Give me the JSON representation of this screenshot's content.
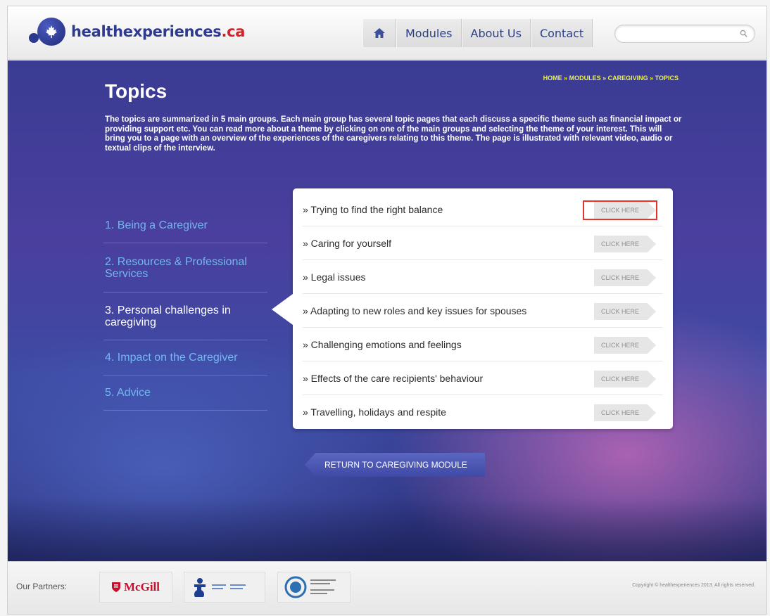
{
  "header": {
    "logo_text": "healthexperiences",
    "logo_tld": ".ca",
    "nav": [
      {
        "label": "",
        "icon": "home-icon"
      },
      {
        "label": "Modules"
      },
      {
        "label": "About Us"
      },
      {
        "label": "Contact"
      }
    ],
    "search": {
      "placeholder": "",
      "value": ""
    }
  },
  "breadcrumb": "HOME » MODULES » CAREGIVING » TOPICS",
  "page": {
    "title": "Topics",
    "intro": "The topics are summarized in 5 main groups. Each main group has several topic pages that each discuss a specific theme such as financial impact or providing support etc. You can read more about a theme by clicking on one of the main groups and selecting the theme of your interest. This will bring you to a page with an overview of the experiences of the caregivers relating to this theme. The page is illustrated with relevant video, audio or textual clips of the interview."
  },
  "groups": [
    {
      "label": "1. Being a Caregiver",
      "active": false
    },
    {
      "label": "2. Resources & Professional Services",
      "active": false
    },
    {
      "label": "3. Personal challenges in caregiving",
      "active": true
    },
    {
      "label": "4. Impact on the Caregiver",
      "active": false
    },
    {
      "label": "5. Advice",
      "active": false
    }
  ],
  "topics": [
    {
      "label": "» Trying to find the right balance",
      "button": "CLICK HERE",
      "highlighted": true
    },
    {
      "label": "» Caring for yourself",
      "button": "CLICK HERE"
    },
    {
      "label": "» Legal issues",
      "button": "CLICK HERE"
    },
    {
      "label": "» Adapting to new roles and key issues for spouses",
      "button": "CLICK HERE"
    },
    {
      "label": "» Challenging emotions and feelings",
      "button": "CLICK HERE"
    },
    {
      "label": "» Effects of the care recipients' behaviour",
      "button": "CLICK HERE"
    },
    {
      "label": "» Travelling, holidays and respite",
      "button": "CLICK HERE"
    }
  ],
  "return_button": "RETURN TO CAREGIVING MODULE",
  "footer": {
    "partners_label": "Our Partners:",
    "partners": [
      {
        "name": "McGill",
        "icon": "mcgill-crest-icon"
      },
      {
        "name": "",
        "icon": "partner-figure-logo-icon"
      },
      {
        "name": "",
        "icon": "partner-globe-logo-icon"
      }
    ],
    "copyright": "Copyright © healthexperiences 2013. All rights reserved."
  },
  "colors": {
    "brand_blue": "#2d3a8f",
    "brand_red": "#d2232a",
    "breadcrumb_yellow": "#e7ef5b",
    "group_link": "#74b7ee",
    "highlight_red": "#e3352d"
  }
}
